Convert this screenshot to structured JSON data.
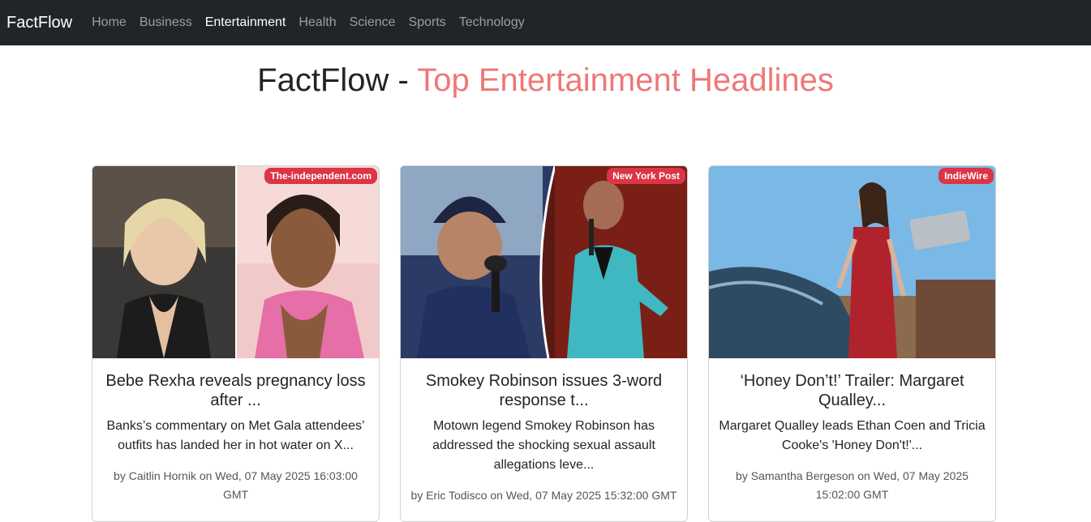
{
  "navbar": {
    "brand": "FactFlow",
    "links": [
      "Home",
      "Business",
      "Entertainment",
      "Health",
      "Science",
      "Sports",
      "Technology"
    ],
    "active_index": 2
  },
  "page": {
    "title_prefix": "FactFlow - ",
    "title_accent": "Top Entertainment Headlines",
    "accent_color": "#ef7777"
  },
  "articles": [
    {
      "source": "The-independent.com",
      "title": "Bebe Rexha reveals pregnancy loss after ...",
      "description": "Banks’s commentary on Met Gala attendees’ outfits has landed her in hot water on X...",
      "meta": "by Caitlin Hornik on Wed, 07 May 2025 16:03:00 GMT"
    },
    {
      "source": "New York Post",
      "title": "Smokey Robinson issues 3-word response t...",
      "description": "Motown legend Smokey Robinson has addressed the shocking sexual assault allegations leve...",
      "meta": "by Eric Todisco on Wed, 07 May 2025 15:32:00 GMT"
    },
    {
      "source": "IndieWire",
      "title": "‘Honey Don’t!’ Trailer: Margaret Qualley...",
      "description": "Margaret Qualley leads Ethan Coen and Tricia Cooke's 'Honey Don't!'...",
      "meta": "by Samantha Bergeson on Wed, 07 May 2025 15:02:00 GMT"
    }
  ],
  "badge_color": "#dc3545"
}
